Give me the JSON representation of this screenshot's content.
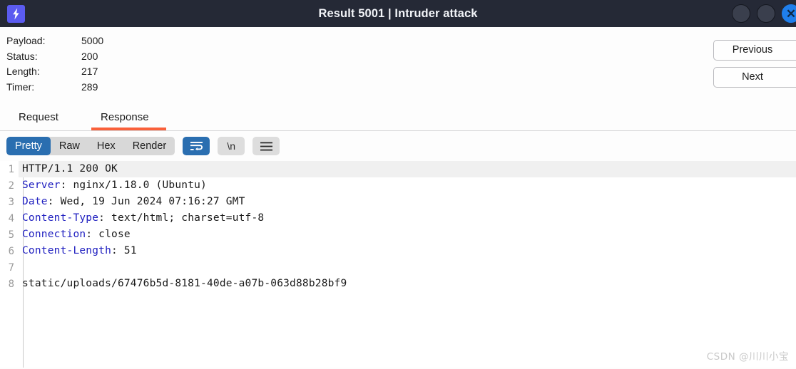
{
  "titlebar": {
    "title": "Result 5001 | Intruder attack",
    "logo_icon": "lightning-bolt-icon",
    "minimize_icon": "minimize-button",
    "maximize_icon": "maximize-button",
    "close_label": "✕",
    "bg_color": "#252936",
    "logo_color": "#5b5bf0",
    "close_color": "#1f7fec"
  },
  "meta": {
    "rows": [
      {
        "label": "Payload:",
        "value": "5000"
      },
      {
        "label": "Status:",
        "value": "200"
      },
      {
        "label": "Length:",
        "value": "217"
      },
      {
        "label": "Timer:",
        "value": "289"
      }
    ]
  },
  "nav": {
    "previous_label": "Previous",
    "next_label": "Next"
  },
  "tabs": {
    "request_label": "Request",
    "response_label": "Response",
    "active": "Response",
    "underline_color": "#f9603a"
  },
  "toolbar": {
    "views": [
      {
        "label": "Pretty",
        "active": true
      },
      {
        "label": "Raw",
        "active": false
      },
      {
        "label": "Hex",
        "active": false
      },
      {
        "label": "Render",
        "active": false
      }
    ],
    "wrap_icon": "word-wrap-icon",
    "wrap_active": true,
    "newline_label": "\\n",
    "menu_icon": "hamburger-menu-icon",
    "active_color": "#2a6eb0"
  },
  "editor": {
    "lines": [
      {
        "no": "1",
        "name": "",
        "rest": "HTTP/1.1 200 OK",
        "highlight": true
      },
      {
        "no": "2",
        "name": "Server",
        "rest": ": nginx/1.18.0 (Ubuntu)",
        "highlight": false
      },
      {
        "no": "3",
        "name": "Date",
        "rest": ": Wed, 19 Jun 2024 07:16:27 GMT",
        "highlight": false
      },
      {
        "no": "4",
        "name": "Content-Type",
        "rest": ": text/html; charset=utf-8",
        "highlight": false
      },
      {
        "no": "5",
        "name": "Connection",
        "rest": ": close",
        "highlight": false
      },
      {
        "no": "6",
        "name": "Content-Length",
        "rest": ": 51",
        "highlight": false
      },
      {
        "no": "7",
        "name": "",
        "rest": "",
        "highlight": false
      },
      {
        "no": "8",
        "name": "",
        "rest": "static/uploads/67476b5d-8181-40de-a07b-063d88b28bf9",
        "highlight": false
      }
    ]
  },
  "watermark": {
    "text": "CSDN @川川小宝"
  }
}
